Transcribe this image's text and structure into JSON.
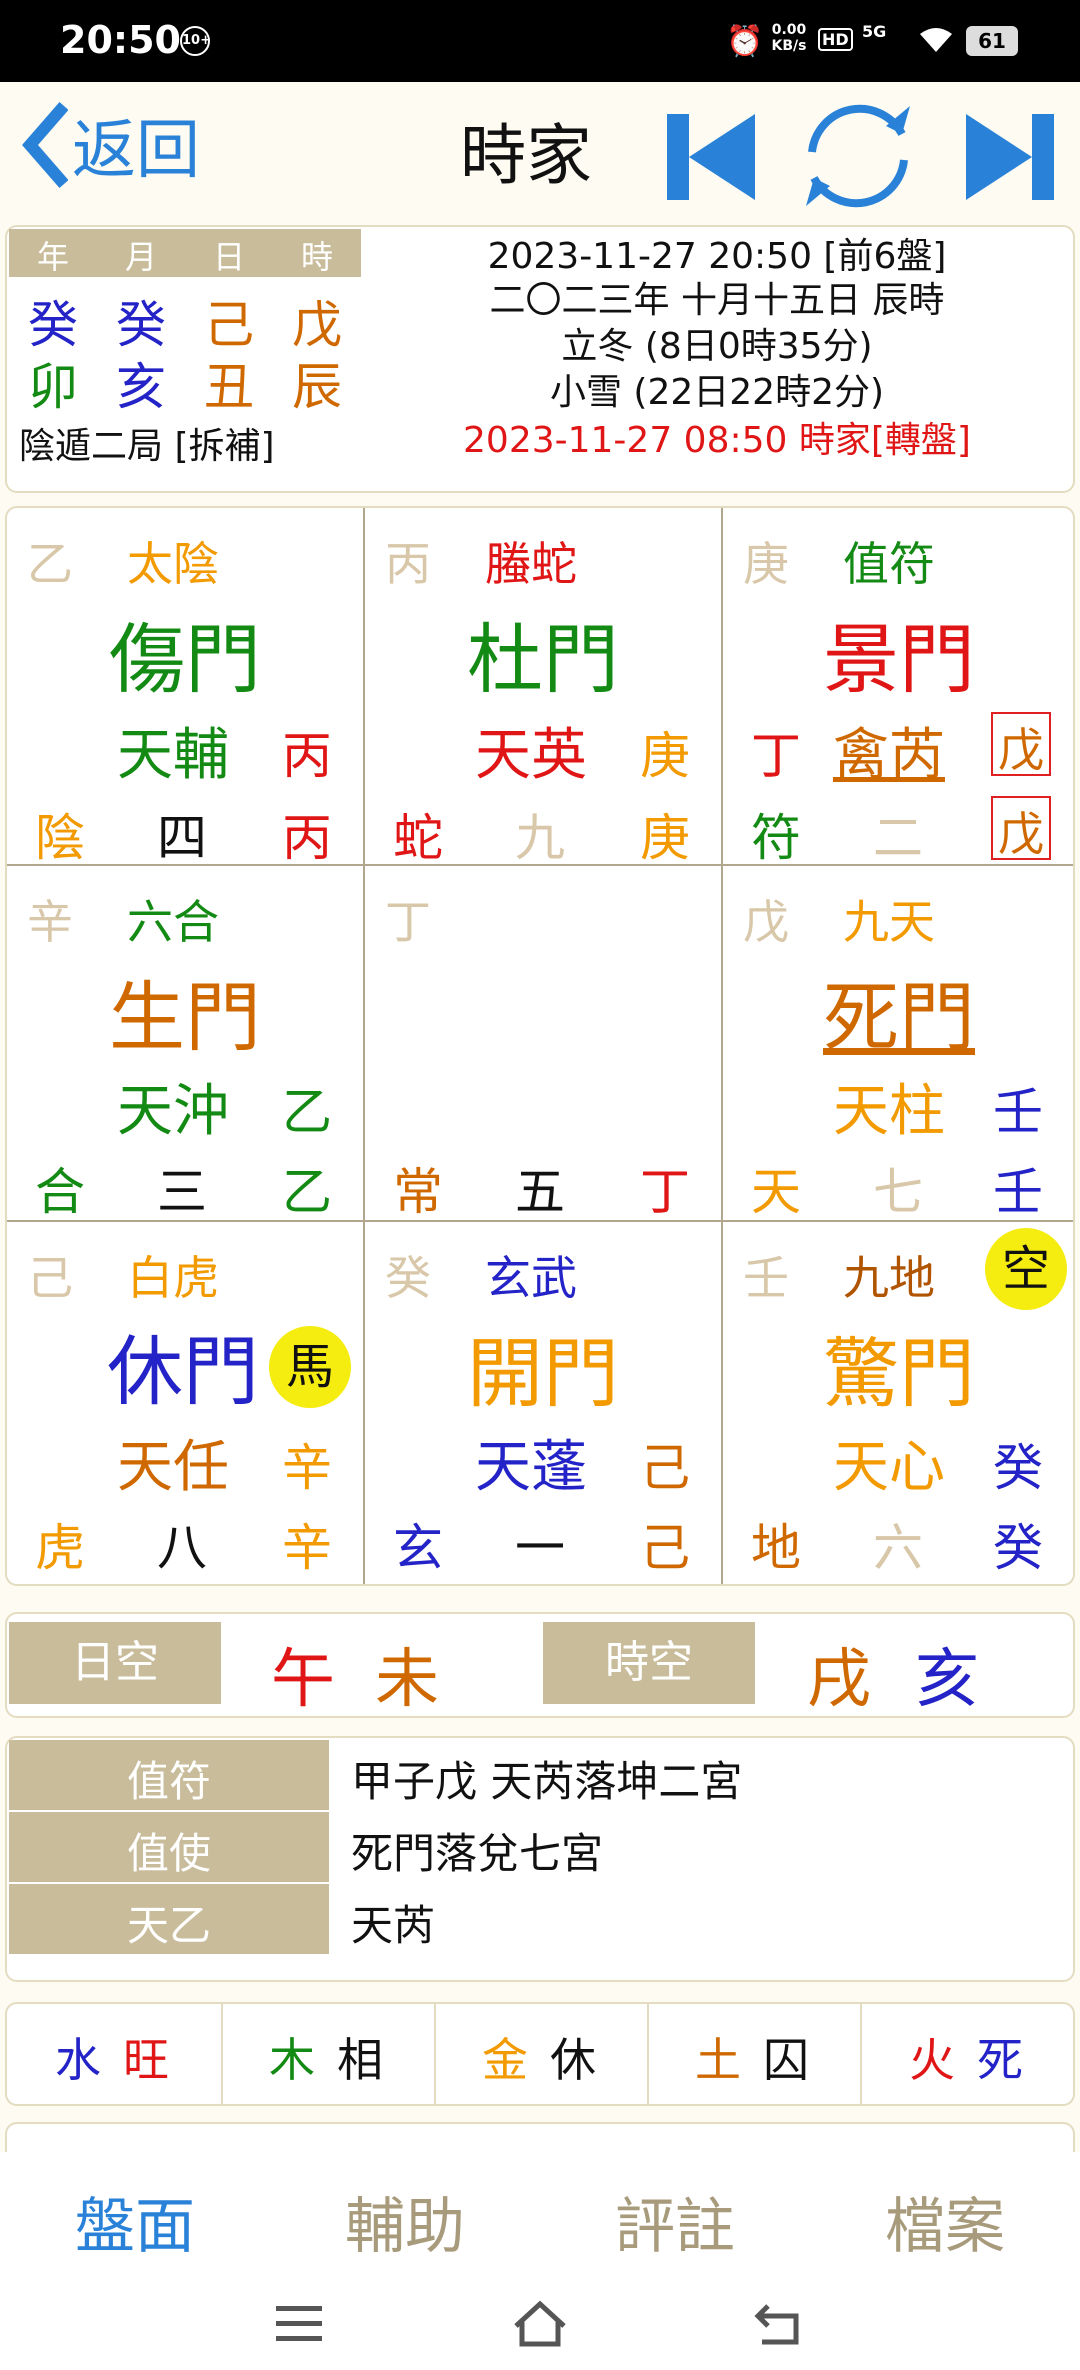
{
  "status": {
    "time": "20:50",
    "notif": "10+",
    "speed": "0.00 KB/s",
    "hd": "HD",
    "net": "5G",
    "battery": "61"
  },
  "nav": {
    "back": "返回",
    "title": "時家"
  },
  "header": {
    "pillars": [
      "年",
      "月",
      "日",
      "時"
    ],
    "stems": [
      "癸",
      "癸",
      "己",
      "戊"
    ],
    "branches": [
      "卯",
      "亥",
      "丑",
      "辰"
    ],
    "ju": "陰遁二局 [拆補]",
    "line1": "2023-11-27 20:50  [前6盤]",
    "line2": "二〇二三年 十月十五日 辰時",
    "line3": "立冬 (8日0時35分)",
    "line4": "小雪 (22日22時2分)",
    "line5": "2023-11-27 08:50 時家[轉盤]"
  },
  "grid": {
    "p1": {
      "a": "乙",
      "b": "太陰",
      "door": "傷門",
      "star": "天輔",
      "sr": "丙",
      "c1": "陰",
      "c2": "四",
      "c3": "丙"
    },
    "p2": {
      "a": "丙",
      "b": "螣蛇",
      "door": "杜門",
      "star": "天英",
      "sr": "庚",
      "c1": "蛇",
      "c2": "九",
      "c3": "庚"
    },
    "p3": {
      "a": "庚",
      "b": "值符",
      "door": "景門",
      "sl": "丁",
      "star": "禽芮",
      "sr": "戊",
      "c1": "符",
      "c2": "二",
      "c3": "戊"
    },
    "p4": {
      "a": "辛",
      "b": "六合",
      "door": "生門",
      "star": "天沖",
      "sr": "乙",
      "c1": "合",
      "c2": "三",
      "c3": "乙"
    },
    "p5": {
      "a": "丁",
      "c1": "常",
      "c2": "五",
      "c3": "丁"
    },
    "p6": {
      "a": "戊",
      "b": "九天",
      "door": "死門",
      "star": "天柱",
      "sr": "壬",
      "c1": "天",
      "c2": "七",
      "c3": "壬"
    },
    "p7": {
      "a": "己",
      "b": "白虎",
      "door": "休門",
      "badge": "馬",
      "star": "天任",
      "sr": "辛",
      "c1": "虎",
      "c2": "八",
      "c3": "辛"
    },
    "p8": {
      "a": "癸",
      "b": "玄武",
      "door": "開門",
      "star": "天蓬",
      "sr": "己",
      "c1": "玄",
      "c2": "一",
      "c3": "己"
    },
    "p9": {
      "a": "壬",
      "b": "九地",
      "badge": "空",
      "door": "驚門",
      "star": "天心",
      "sr": "癸",
      "c1": "地",
      "c2": "六",
      "c3": "癸"
    }
  },
  "void": {
    "day_label": "日空",
    "day1": "午",
    "day2": "未",
    "hour_label": "時空",
    "hour1": "戌",
    "hour2": "亥"
  },
  "info": {
    "rows": [
      {
        "label": "值符",
        "value": "甲子戊  天芮落坤二宮"
      },
      {
        "label": "值使",
        "value": "死門落兌七宮"
      },
      {
        "label": "天乙",
        "value": "天芮"
      }
    ]
  },
  "wuxing": [
    {
      "el": "水",
      "st": "旺"
    },
    {
      "el": "木",
      "st": "相"
    },
    {
      "el": "金",
      "st": "休"
    },
    {
      "el": "土",
      "st": "囚"
    },
    {
      "el": "火",
      "st": "死"
    }
  ],
  "tabs": [
    "盤面",
    "輔助",
    "評註",
    "檔案"
  ],
  "colors": {
    "blue": "#2323c8",
    "green": "#138a13",
    "red": "#e01616",
    "orange": "#d06800",
    "gold": "#f29a00",
    "pale": "#d8c7a8",
    "tan": "#c9bc9a",
    "accent": "#2a82d8"
  }
}
